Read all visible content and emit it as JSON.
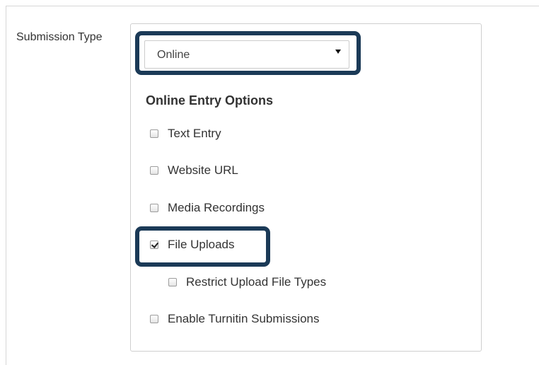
{
  "submission": {
    "label": "Submission Type",
    "select_value": "Online",
    "options_heading": "Online Entry Options",
    "options": [
      {
        "label": "Text Entry",
        "checked": false
      },
      {
        "label": "Website URL",
        "checked": false
      },
      {
        "label": "Media Recordings",
        "checked": false
      },
      {
        "label": "File Uploads",
        "checked": true
      },
      {
        "label": "Restrict Upload File Types",
        "checked": false
      },
      {
        "label": "Enable Turnitin Submissions",
        "checked": false
      }
    ]
  },
  "icons": {
    "select_arrow": "caret-down-icon"
  },
  "colors": {
    "highlight": "#1b3a57",
    "border": "#cfcfcf",
    "text": "#333333"
  }
}
